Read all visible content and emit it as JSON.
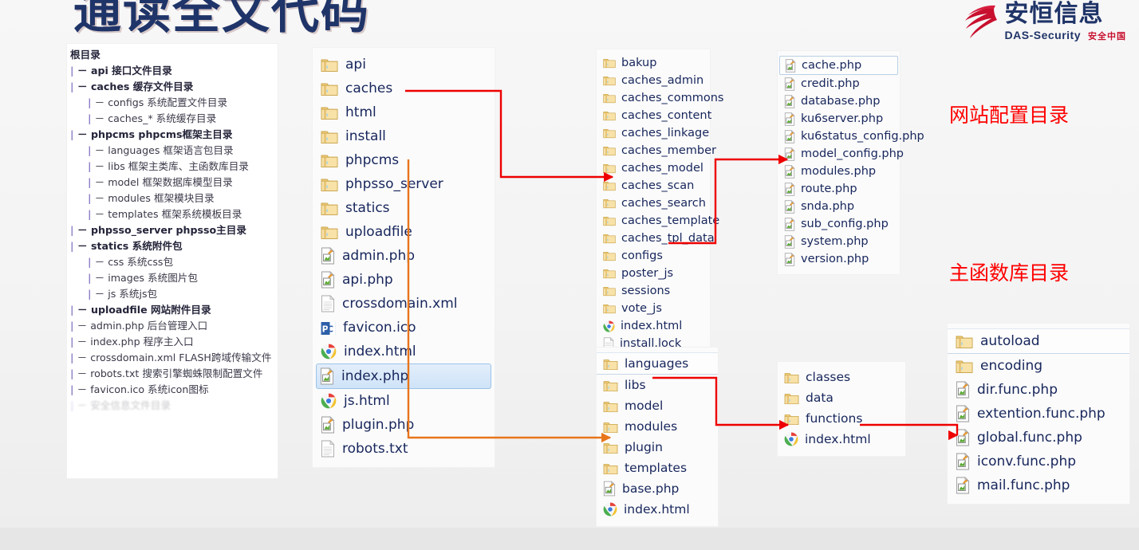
{
  "title": "通读全文代码",
  "logo": {
    "cn": "安恒信息",
    "en": "DAS-Security",
    "slogan": "安全中国",
    "mark": "swoosh-logo-icon"
  },
  "annotations": {
    "config_dir": "网站配置目录",
    "func_lib_dir": "主函数库目录"
  },
  "colors": {
    "title_blue": "#1f3468",
    "annotation_red": "#ff0000",
    "arrow_red": "#ee0000",
    "arrow_orange": "#e8751a",
    "folder_yellow": "#f5d27a",
    "selection_blue": "#cfe3f8"
  },
  "outline": {
    "header": "根目录",
    "rows": [
      {
        "level": 1,
        "bold": true,
        "pipe": "|",
        "text": "－ api  接口文件目录"
      },
      {
        "level": 1,
        "bold": true,
        "pipe": "|",
        "text": "－ caches 缓存文件目录"
      },
      {
        "level": 2,
        "bold": false,
        "pipe": "|",
        "text": "－ configs 系统配置文件目录"
      },
      {
        "level": 2,
        "bold": false,
        "pipe": "|",
        "text": "－ caches_* 系统缓存目录"
      },
      {
        "level": 1,
        "bold": true,
        "pipe": "|",
        "text": "－ phpcms  phpcms框架主目录"
      },
      {
        "level": 2,
        "bold": false,
        "pipe": "|",
        "text": "－ languages 框架语言包目录"
      },
      {
        "level": 2,
        "bold": false,
        "pipe": "|",
        "text": "－ libs 框架主类库、主函数库目录"
      },
      {
        "level": 2,
        "bold": false,
        "pipe": "|",
        "text": "－ model 框架数据库模型目录"
      },
      {
        "level": 2,
        "bold": false,
        "pipe": "|",
        "text": "－ modules 框架模块目录"
      },
      {
        "level": 2,
        "bold": false,
        "pipe": "|",
        "text": "－ templates 框架系统模板目录"
      },
      {
        "level": 1,
        "bold": true,
        "pipe": "|",
        "text": "－ phpsso_server  phpsso主目录"
      },
      {
        "level": 1,
        "bold": true,
        "pipe": "|",
        "text": "－ statics  系统附件包"
      },
      {
        "level": 2,
        "bold": false,
        "pipe": "|",
        "text": "－ css 系统css包"
      },
      {
        "level": 2,
        "bold": false,
        "pipe": "|",
        "text": "－ images 系统图片包"
      },
      {
        "level": 2,
        "bold": false,
        "pipe": "|",
        "text": "－ js 系统js包"
      },
      {
        "level": 1,
        "bold": true,
        "pipe": "|",
        "text": "－ uploadfile  网站附件目录"
      },
      {
        "level": 1,
        "bold": false,
        "pipe": "|",
        "text": "－ admin.php  后台管理入口"
      },
      {
        "level": 1,
        "bold": false,
        "pipe": "|",
        "text": "－ index.php  程序主入口"
      },
      {
        "level": 1,
        "bold": false,
        "pipe": "|",
        "text": "－ crossdomain.xml  FLASH跨域传输文件"
      },
      {
        "level": 1,
        "bold": false,
        "pipe": "|",
        "text": "－ robots.txt 搜索引擎蜘蛛限制配置文件"
      },
      {
        "level": 1,
        "bold": false,
        "pipe": "|",
        "text": "－ favicon.ico  系统icon图标"
      },
      {
        "level": 1,
        "bold": false,
        "pipe": "|",
        "text": "－ 安全信息文件目录",
        "faded": true
      }
    ]
  },
  "panels": {
    "root": {
      "name": "root-directory-listing",
      "items": [
        {
          "name": "api",
          "icon": "folder-icon",
          "type": "folder"
        },
        {
          "name": "caches",
          "icon": "folder-icon",
          "type": "folder"
        },
        {
          "name": "html",
          "icon": "folder-icon",
          "type": "folder"
        },
        {
          "name": "install",
          "icon": "folder-icon",
          "type": "folder"
        },
        {
          "name": "phpcms",
          "icon": "folder-icon",
          "type": "folder"
        },
        {
          "name": "phpsso_server",
          "icon": "folder-icon",
          "type": "folder"
        },
        {
          "name": "statics",
          "icon": "folder-icon",
          "type": "folder"
        },
        {
          "name": "uploadfile",
          "icon": "folder-icon",
          "type": "folder"
        },
        {
          "name": "admin.php",
          "icon": "php-file-icon",
          "type": "php"
        },
        {
          "name": "api.php",
          "icon": "php-file-icon",
          "type": "php"
        },
        {
          "name": "crossdomain.xml",
          "icon": "text-file-icon",
          "type": "text"
        },
        {
          "name": "favicon.ico",
          "icon": "pc-icon-file-icon",
          "type": "ico"
        },
        {
          "name": "index.html",
          "icon": "chrome-icon",
          "type": "html"
        },
        {
          "name": "index.php",
          "icon": "php-file-icon",
          "type": "php",
          "selected": true
        },
        {
          "name": "js.html",
          "icon": "chrome-icon",
          "type": "html"
        },
        {
          "name": "plugin.php",
          "icon": "php-file-icon",
          "type": "php"
        },
        {
          "name": "robots.txt",
          "icon": "text-file-icon",
          "type": "text"
        }
      ]
    },
    "caches": {
      "name": "caches-directory-listing",
      "items": [
        {
          "name": "bakup",
          "icon": "folder-icon",
          "type": "folder"
        },
        {
          "name": "caches_admin",
          "icon": "folder-icon",
          "type": "folder"
        },
        {
          "name": "caches_commons",
          "icon": "folder-icon",
          "type": "folder"
        },
        {
          "name": "caches_content",
          "icon": "folder-icon",
          "type": "folder"
        },
        {
          "name": "caches_linkage",
          "icon": "folder-icon",
          "type": "folder"
        },
        {
          "name": "caches_member",
          "icon": "folder-icon",
          "type": "folder"
        },
        {
          "name": "caches_model",
          "icon": "folder-icon",
          "type": "folder"
        },
        {
          "name": "caches_scan",
          "icon": "folder-icon",
          "type": "folder"
        },
        {
          "name": "caches_search",
          "icon": "folder-icon",
          "type": "folder"
        },
        {
          "name": "caches_template",
          "icon": "folder-icon",
          "type": "folder"
        },
        {
          "name": "caches_tpl_data",
          "icon": "folder-icon",
          "type": "folder"
        },
        {
          "name": "configs",
          "icon": "folder-icon",
          "type": "folder"
        },
        {
          "name": "poster_js",
          "icon": "folder-icon",
          "type": "folder"
        },
        {
          "name": "sessions",
          "icon": "folder-icon",
          "type": "folder"
        },
        {
          "name": "vote_js",
          "icon": "folder-icon",
          "type": "folder"
        },
        {
          "name": "index.html",
          "icon": "chrome-icon",
          "type": "html"
        },
        {
          "name": "install.lock",
          "icon": "text-file-icon",
          "type": "text"
        }
      ]
    },
    "configs": {
      "name": "configs-directory-listing",
      "items": [
        {
          "name": "cache.php",
          "icon": "php-file-icon",
          "type": "php",
          "outlined": true
        },
        {
          "name": "credit.php",
          "icon": "php-file-icon",
          "type": "php"
        },
        {
          "name": "database.php",
          "icon": "php-file-icon",
          "type": "php"
        },
        {
          "name": "ku6server.php",
          "icon": "php-file-icon",
          "type": "php"
        },
        {
          "name": "ku6status_config.php",
          "icon": "php-file-icon",
          "type": "php"
        },
        {
          "name": "model_config.php",
          "icon": "php-file-icon",
          "type": "php"
        },
        {
          "name": "modules.php",
          "icon": "php-file-icon",
          "type": "php"
        },
        {
          "name": "route.php",
          "icon": "php-file-icon",
          "type": "php"
        },
        {
          "name": "snda.php",
          "icon": "php-file-icon",
          "type": "php"
        },
        {
          "name": "sub_config.php",
          "icon": "php-file-icon",
          "type": "php"
        },
        {
          "name": "system.php",
          "icon": "php-file-icon",
          "type": "php"
        },
        {
          "name": "version.php",
          "icon": "php-file-icon",
          "type": "php"
        }
      ]
    },
    "phpcms": {
      "name": "phpcms-directory-listing",
      "items": [
        {
          "name": "languages",
          "icon": "folder-icon",
          "type": "folder",
          "band": true
        },
        {
          "name": "libs",
          "icon": "folder-icon",
          "type": "folder"
        },
        {
          "name": "model",
          "icon": "folder-icon",
          "type": "folder"
        },
        {
          "name": "modules",
          "icon": "folder-icon",
          "type": "folder"
        },
        {
          "name": "plugin",
          "icon": "folder-icon",
          "type": "folder"
        },
        {
          "name": "templates",
          "icon": "folder-icon",
          "type": "folder"
        },
        {
          "name": "base.php",
          "icon": "php-file-icon",
          "type": "php"
        },
        {
          "name": "index.html",
          "icon": "chrome-icon",
          "type": "html"
        }
      ]
    },
    "libs": {
      "name": "libs-directory-listing",
      "items": [
        {
          "name": "classes",
          "icon": "folder-icon",
          "type": "folder"
        },
        {
          "name": "data",
          "icon": "folder-icon",
          "type": "folder"
        },
        {
          "name": "functions",
          "icon": "folder-icon",
          "type": "folder"
        },
        {
          "name": "index.html",
          "icon": "chrome-icon",
          "type": "html"
        }
      ]
    },
    "functions": {
      "name": "functions-directory-listing",
      "items": [
        {
          "name": "autoload",
          "icon": "folder-icon",
          "type": "folder",
          "band": true
        },
        {
          "name": "encoding",
          "icon": "folder-icon",
          "type": "folder"
        },
        {
          "name": "dir.func.php",
          "icon": "php-file-icon",
          "type": "php"
        },
        {
          "name": "extention.func.php",
          "icon": "php-file-icon",
          "type": "php"
        },
        {
          "name": "global.func.php",
          "icon": "php-file-icon",
          "type": "php"
        },
        {
          "name": "iconv.func.php",
          "icon": "php-file-icon",
          "type": "php"
        },
        {
          "name": "mail.func.php",
          "icon": "php-file-icon",
          "type": "php"
        }
      ]
    }
  },
  "connectors": [
    {
      "name": "caches-to-caches-scan-arrow",
      "color": "#ee0000",
      "from": "caches",
      "to": "caches_scan"
    },
    {
      "name": "configs-to-modules-arrow",
      "color": "#ee0000",
      "from": "configs",
      "to": "modules.php"
    },
    {
      "name": "libs-to-functions-arrow",
      "color": "#ee0000",
      "from": "libs",
      "to": "functions"
    },
    {
      "name": "functions-to-global-func-arrow",
      "color": "#ee0000",
      "from": "functions",
      "to": "global.func.php"
    },
    {
      "name": "phpcms-to-plugin-arrow",
      "color": "#e8751a",
      "from": "phpcms",
      "to": "plugin"
    }
  ]
}
